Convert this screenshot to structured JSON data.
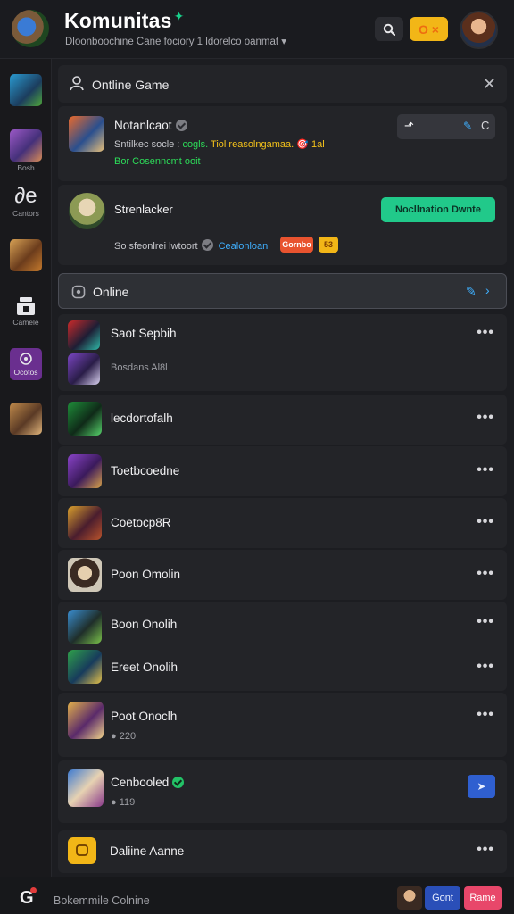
{
  "header": {
    "title": "Komunitas",
    "subtitle": "Dloonboochine Cane fociory  1 ldorelco oanmat",
    "coins": "O ×"
  },
  "sidebar": {
    "items": [
      {
        "label": ""
      },
      {
        "label": "Bosh"
      },
      {
        "label": "Cantors",
        "glyph": "∂e"
      },
      {
        "label": ""
      },
      {
        "label": "Camele"
      },
      {
        "label": "Ocotos"
      },
      {
        "label": ""
      }
    ]
  },
  "top_card": {
    "title": "Ontline Game"
  },
  "notification": {
    "name": "Notanlcaot",
    "line1_prefix": "Sntilkec socle :",
    "line1_mid": "cogls.",
    "line1_suffix": "Tiol reasolngamaa. 🎯",
    "line1_tail": "1al",
    "line2": "Bor Cosenncmt ooit"
  },
  "profile": {
    "name": "Strenlacker",
    "status_prefix": "So sfeonlrei lwtoort",
    "link": "Cealonloan",
    "chip_1": "Gornbo",
    "chip_2": "53",
    "button": "Nocllnation Dwnte"
  },
  "online_section": {
    "label": "Online"
  },
  "list": [
    {
      "name": "Saot Sepbih",
      "sub": "Bosdans Al8l"
    },
    {
      "name": "lecdortofalh"
    },
    {
      "name": "Toetbcoedne"
    },
    {
      "name": "Coetocp8R"
    },
    {
      "name": "Poon Omolin"
    },
    {
      "name": "Boon Onolih",
      "name2": "Ereet Onolih"
    },
    {
      "name": "Poot Onoclh",
      "sub": "220"
    },
    {
      "name": "Cenbooled",
      "sub": "119"
    },
    {
      "name": "Daliine Aanne"
    }
  ],
  "bottombar": {
    "logo": "G",
    "text": "Bokemmile Colnine",
    "btn_blue": "Gont",
    "btn_pink": "Rame"
  },
  "colors": {
    "accent_green": "#21c98a",
    "coin_yellow": "#f2b617",
    "verified_green": "#23c267",
    "link_blue": "#3fb0ff",
    "bg": "#1c1d21",
    "panel": "#232428"
  },
  "icons": [
    "search-icon",
    "coin-icon",
    "user-icon",
    "close-icon",
    "verified-icon",
    "more-icon",
    "chevron-right-icon",
    "notification-dot-icon"
  ]
}
